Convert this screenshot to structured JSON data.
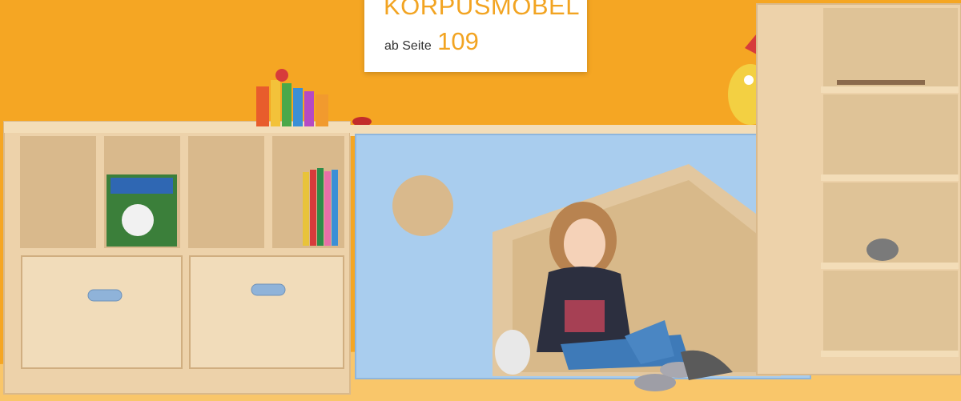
{
  "label": {
    "title": "KORPUSMÖBEL",
    "sub_text": "ab Seite",
    "page_number": "109"
  },
  "colors": {
    "background": "#F5A623",
    "floor": "#F9C66A",
    "accent_text": "#F2A422",
    "wood": "#EDD2AA",
    "wood_dark": "#D9B98C",
    "blue_panel": "#A9CDEE"
  }
}
